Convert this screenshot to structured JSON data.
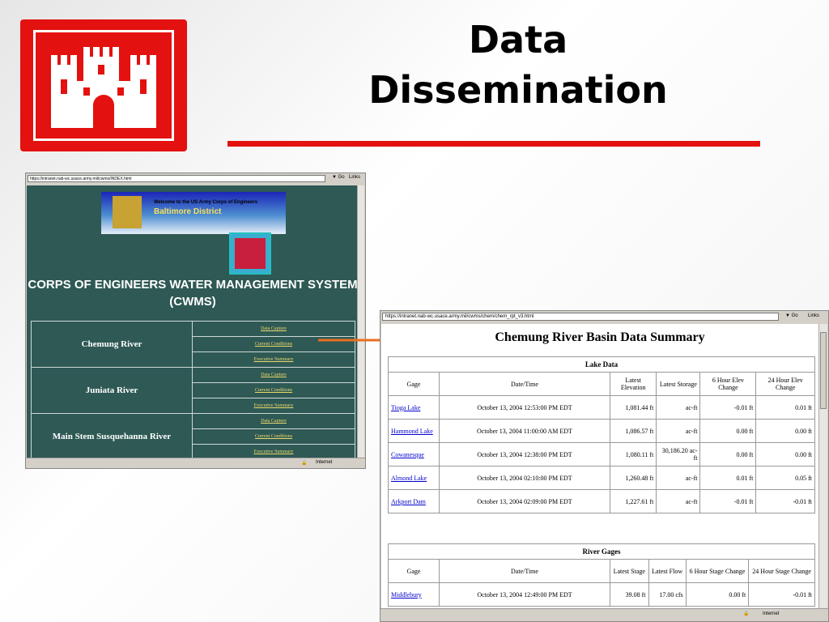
{
  "slide": {
    "title_line1": "Data",
    "title_line2": "Dissemination"
  },
  "window1": {
    "url": "https://intranet.nab-wc.usace.army.mil/cwms/INDEX.html",
    "go_label": "Go",
    "links_label": "Links",
    "status_zone": "Internet",
    "banner_welcome": "Welcome to the US Army Corps of Engineers",
    "banner_district": "Baltimore District",
    "heading_line1": "CORPS OF ENGINEERS WATER MANAGEMENT SYSTEM",
    "heading_line2": "(CWMS)",
    "rivers": [
      {
        "name": "Chemung River",
        "links": [
          "Data Capture",
          "Current Conditions",
          "Executive Summary"
        ]
      },
      {
        "name": "Juniata River",
        "links": [
          "Data Capture",
          "Current Conditions",
          "Executive Summary"
        ]
      },
      {
        "name": "Main Stem Susquehanna River",
        "links": [
          "Data Capture",
          "Current Conditions",
          "Executive Summary"
        ]
      }
    ]
  },
  "window2": {
    "url": "https://intranet.nab-wc.usace.army.mil/cwms/chem/chem_rpt_v3.html",
    "go_label": "Go",
    "links_label": "Links",
    "status_zone": "Internet",
    "page_title": "Chemung River Basin Data Summary",
    "lake_table": {
      "caption": "Lake Data",
      "headers": [
        "Gage",
        "Date/Time",
        "Latest Elevation",
        "Latest Storage",
        "6 Hour Elev Change",
        "24 Hour Elev Change"
      ],
      "rows": [
        [
          "Tioga Lake",
          "October 13, 2004 12:53:00 PM EDT",
          "1,081.44 ft",
          "ac-ft",
          "-0.01 ft",
          "0.01 ft"
        ],
        [
          "Hammond Lake",
          "October 13, 2004 11:00:00 AM EDT",
          "1,086.57 ft",
          "ac-ft",
          "0.00 ft",
          "0.00 ft"
        ],
        [
          "Cowanesque",
          "October 13, 2004 12:38:00 PM EDT",
          "1,080.11 ft",
          "30,186.20 ac-ft",
          "0.00 ft",
          "0.00 ft"
        ],
        [
          "Almond Lake",
          "October 13, 2004 02:10:00 PM EDT",
          "1,260.48 ft",
          "ac-ft",
          "0.01 ft",
          "0.05 ft"
        ],
        [
          "Arkport Dam",
          "October 13, 2004 02:09:00 PM EDT",
          "1,227.61 ft",
          "ac-ft",
          "-0.01 ft",
          "-0.01 ft"
        ]
      ]
    },
    "river_table": {
      "caption": "River Gages",
      "headers": [
        "Gage",
        "Date/Time",
        "Latest Stage",
        "Latest Flow",
        "6 Hour Stage Change",
        "24 Hour Stage Change"
      ],
      "rows": [
        [
          "Middlebury",
          "October 13, 2004 12:49:00 PM EDT",
          "39.08 ft",
          "17.00 cfs",
          "0.00 ft",
          "-0.01 ft"
        ]
      ]
    }
  },
  "colors": {
    "accent_red": "#e3110f",
    "page1_bg": "#2e5955"
  }
}
